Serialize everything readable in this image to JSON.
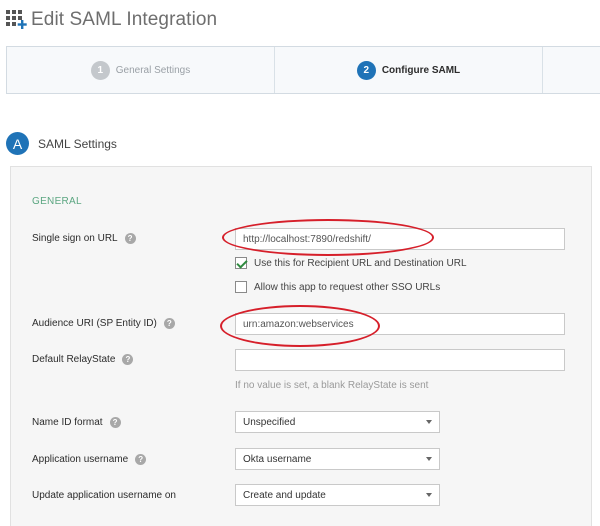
{
  "page": {
    "title": "Edit SAML Integration",
    "icon": "app-grid-plus-icon"
  },
  "wizard": {
    "steps": [
      {
        "number": "1",
        "label": "General Settings",
        "state": "inactive"
      },
      {
        "number": "2",
        "label": "Configure SAML",
        "state": "active"
      }
    ]
  },
  "section": {
    "badge": "A",
    "title": "SAML Settings"
  },
  "general": {
    "group_label": "GENERAL",
    "sso_url": {
      "label": "Single sign on URL",
      "value": "http://localhost:7890/redshift/"
    },
    "recipient_check": {
      "label": "Use this for Recipient URL and Destination URL",
      "checked": true
    },
    "other_sso_check": {
      "label": "Allow this app to request other SSO URLs",
      "checked": false
    },
    "audience_uri": {
      "label": "Audience URI (SP Entity ID)",
      "value": "urn:amazon:webservices"
    },
    "relay_state": {
      "label": "Default RelayState",
      "value": "",
      "hint": "If no value is set, a blank RelayState is sent"
    },
    "name_id_format": {
      "label": "Name ID format",
      "value": "Unspecified"
    },
    "app_username": {
      "label": "Application username",
      "value": "Okta username"
    },
    "update_username": {
      "label": "Update application username on",
      "value": "Create and update"
    }
  },
  "colors": {
    "accent": "#1f73b7",
    "group_label": "#5ba681",
    "annotation": "#d61f2a",
    "check": "#2f8a3f"
  }
}
